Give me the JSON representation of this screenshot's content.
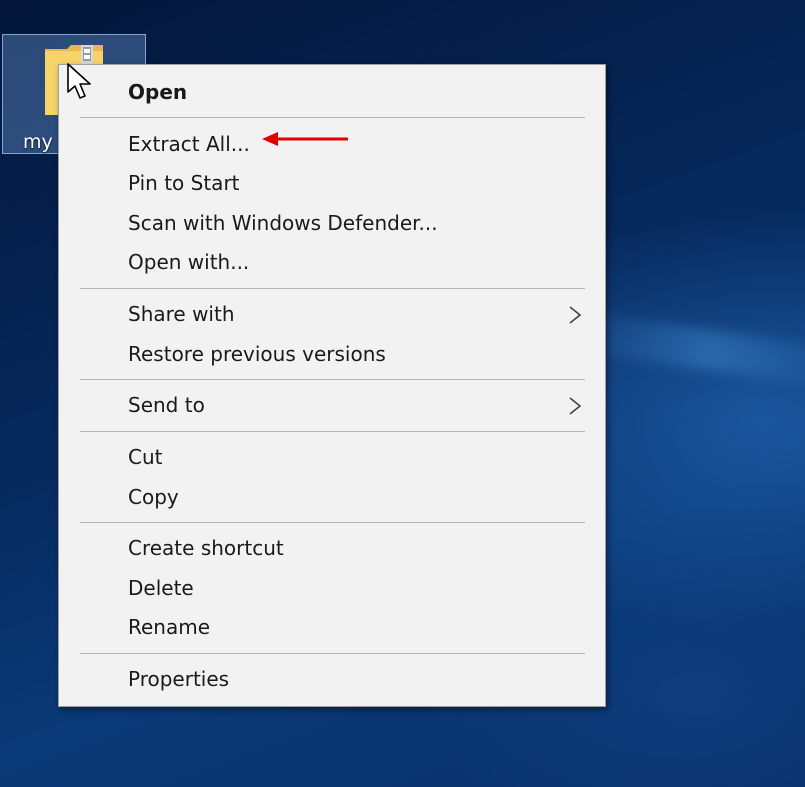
{
  "desktop": {
    "icon_label": "my",
    "icon_name": "zip-folder-icon"
  },
  "menu": {
    "open": "Open",
    "extract_all": "Extract All...",
    "pin_to_start": "Pin to Start",
    "scan_defender": "Scan with Windows Defender...",
    "open_with": "Open with...",
    "share_with": "Share with",
    "restore_versions": "Restore previous versions",
    "send_to": "Send to",
    "cut": "Cut",
    "copy": "Copy",
    "create_shortcut": "Create shortcut",
    "delete": "Delete",
    "rename": "Rename",
    "properties": "Properties"
  },
  "annotation": {
    "arrow_color": "#e00000",
    "points_to": "Extract All..."
  },
  "colors": {
    "menu_bg": "#f2f2f2",
    "desktop_bg": "#062a5e",
    "folder": "#f6d36b"
  }
}
